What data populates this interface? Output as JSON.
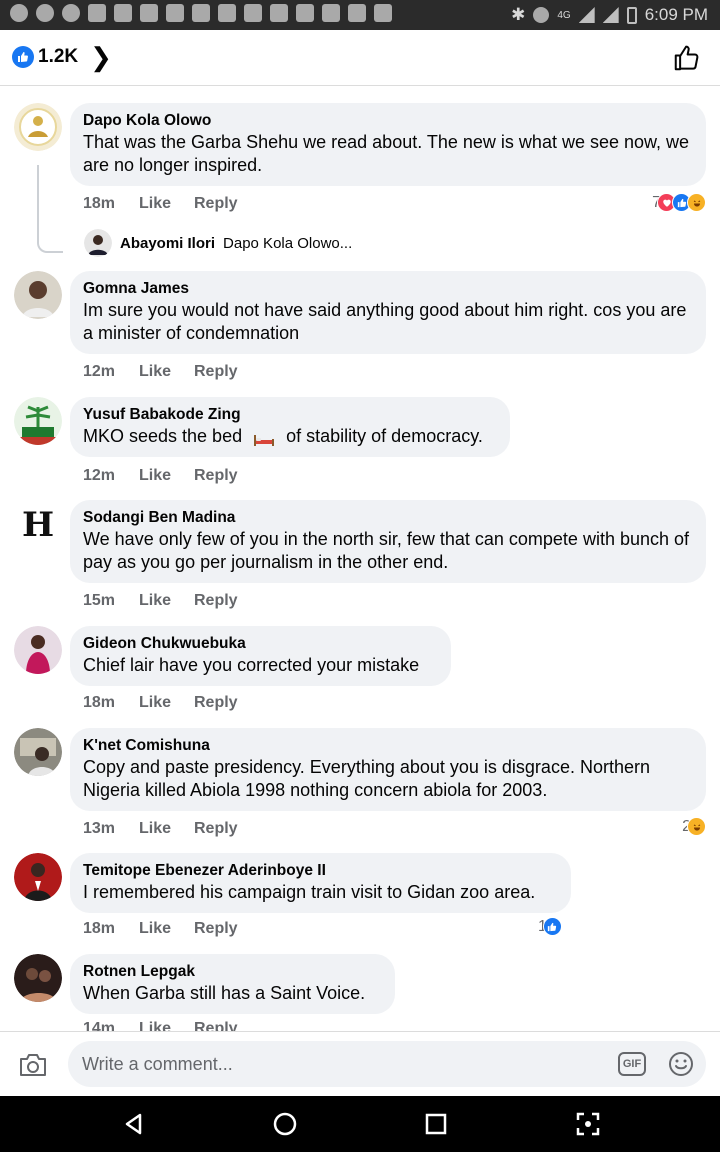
{
  "status_bar": {
    "time": "6:09 PM",
    "network": "4G"
  },
  "header": {
    "reaction_count": "1.2K"
  },
  "comments": [
    {
      "author": "Dapo Kola Olowo",
      "text": "That was the Garba Shehu we read about. The new is what we see now, we are no longer inspired.",
      "time": "18m",
      "like_label": "Like",
      "reply_label": "Reply",
      "reaction_count": "7",
      "reply_preview": {
        "author": "Abayomi Ilori",
        "text": "Dapo Kola Olowo..."
      }
    },
    {
      "author": "Gomna James",
      "text": "Im sure you would not have said anything good about him right. cos you are a minister of condemnation",
      "time": "12m",
      "like_label": "Like",
      "reply_label": "Reply"
    },
    {
      "author": "Yusuf Babakode Zing",
      "text_before": "MKO seeds the bed",
      "text_after": "of stability of democracy.",
      "time": "12m",
      "like_label": "Like",
      "reply_label": "Reply"
    },
    {
      "author": "Sodangi Ben Madina",
      "text": "We have only few of you in the north sir, few that can compete with bunch of pay as you go per journalism in the other end.",
      "time": "15m",
      "like_label": "Like",
      "reply_label": "Reply"
    },
    {
      "author": "Gideon Chukwuebuka",
      "text": "Chief lair have you corrected your mistake",
      "time": "18m",
      "like_label": "Like",
      "reply_label": "Reply"
    },
    {
      "author": "K'net Comishuna",
      "text": "Copy and paste presidency. Everything about you is disgrace. Northern Nigeria killed Abiola 1998 nothing concern abiola for 2003.",
      "time": "13m",
      "like_label": "Like",
      "reply_label": "Reply",
      "reaction_count": "2"
    },
    {
      "author": "Temitope Ebenezer Aderinboye II",
      "text": "I remembered his campaign train visit to Gidan zoo area.",
      "time": "18m",
      "like_label": "Like",
      "reply_label": "Reply",
      "reaction_count": "1"
    },
    {
      "author": "Rotnen Lepgak",
      "text": "When Garba still  has a Saint Voice.",
      "time": "14m",
      "like_label": "Like",
      "reply_label": "Reply"
    }
  ],
  "composer": {
    "placeholder": "Write a comment...",
    "gif_label": "GIF"
  }
}
